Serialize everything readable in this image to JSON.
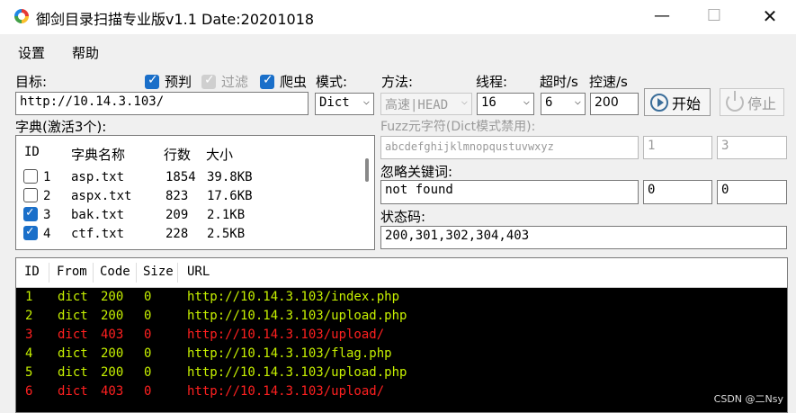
{
  "window": {
    "title": "御剑目录扫描专业版v1.1 Date:20201018",
    "minimize": "—",
    "maximize": "☐",
    "close": "✕"
  },
  "menu": [
    "设置",
    "帮助"
  ],
  "target": {
    "label": "目标:",
    "value": "http://10.14.3.103/"
  },
  "options": {
    "prejudge_label": "预判",
    "prejudge_checked": true,
    "filter_label": "过滤",
    "filter_checked": true,
    "filter_disabled": true,
    "crawler_label": "爬虫",
    "crawler_checked": true
  },
  "mode": {
    "label": "模式:",
    "value": "Dict"
  },
  "method": {
    "label": "方法:",
    "value": "高速|HEAD"
  },
  "threads": {
    "label": "线程:",
    "value": "16"
  },
  "timeout": {
    "label": "超时/s",
    "value": "6"
  },
  "speed": {
    "label": "控速/s",
    "value": "200"
  },
  "buttons": {
    "start": "开始",
    "stop": "停止"
  },
  "dict": {
    "label": "字典(激活3个):",
    "columns": [
      "ID",
      "字典名称",
      "行数",
      "大小"
    ],
    "rows": [
      {
        "checked": false,
        "id": "1",
        "name": "asp.txt",
        "lines": "1854",
        "size": "39.8KB"
      },
      {
        "checked": false,
        "id": "2",
        "name": "aspx.txt",
        "lines": "823",
        "size": "17.6KB"
      },
      {
        "checked": true,
        "id": "3",
        "name": "bak.txt",
        "lines": "209",
        "size": "2.1KB"
      },
      {
        "checked": true,
        "id": "4",
        "name": "ctf.txt",
        "lines": "228",
        "size": "2.5KB"
      }
    ]
  },
  "fuzz": {
    "label": "Fuzz元字符(Dict模式禁用):",
    "charset": "abcdefghijklmnopqustuvwxyz",
    "min": "1",
    "max": "3"
  },
  "ignore": {
    "label": "忽略关键词:",
    "value": "not found",
    "a": "0",
    "b": "0"
  },
  "status": {
    "label": "状态码:",
    "value": "200,301,302,304,403"
  },
  "results": {
    "columns": [
      "ID",
      "From",
      "Code",
      "Size",
      "URL"
    ],
    "rows": [
      {
        "id": "1",
        "from": "dict",
        "code": "200",
        "size": "0",
        "url": "http://10.14.3.103/index.php",
        "color": "#c6f000"
      },
      {
        "id": "2",
        "from": "dict",
        "code": "200",
        "size": "0",
        "url": "http://10.14.3.103/upload.php",
        "color": "#c6f000"
      },
      {
        "id": "3",
        "from": "dict",
        "code": "403",
        "size": "0",
        "url": "http://10.14.3.103/upload/",
        "color": "#ff2020"
      },
      {
        "id": "4",
        "from": "dict",
        "code": "200",
        "size": "0",
        "url": "http://10.14.3.103/flag.php",
        "color": "#c6f000"
      },
      {
        "id": "5",
        "from": "dict",
        "code": "200",
        "size": "0",
        "url": "http://10.14.3.103/upload.php",
        "color": "#c6f000"
      },
      {
        "id": "6",
        "from": "dict",
        "code": "403",
        "size": "0",
        "url": "http://10.14.3.103/upload/",
        "color": "#ff2020"
      }
    ]
  },
  "watermark": "CSDN @二Nsy"
}
